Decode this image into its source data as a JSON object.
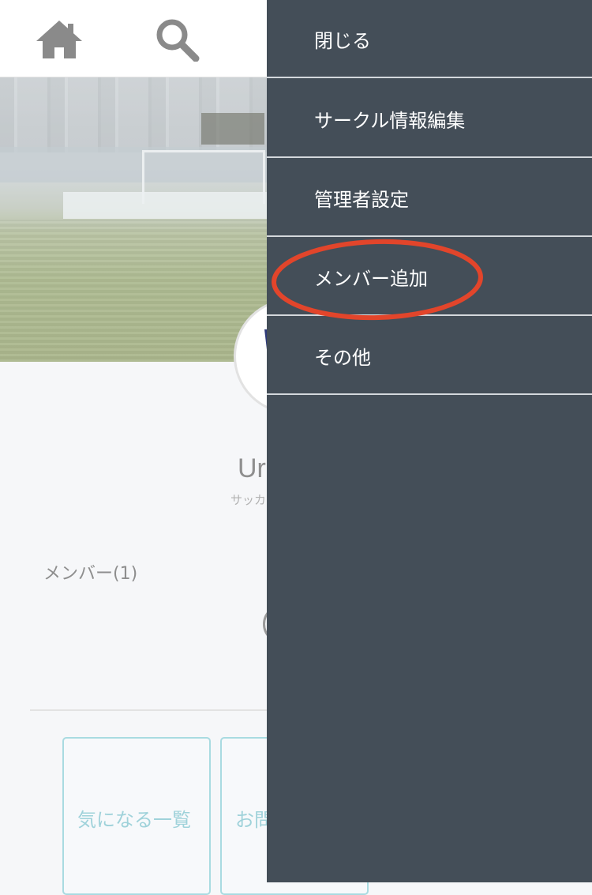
{
  "header": {
    "home_icon": "home-icon",
    "search_icon": "search-icon"
  },
  "circle": {
    "name_partial": "Ur",
    "category_partial": "サッカ"
  },
  "members": {
    "label": "メンバー(1)"
  },
  "actions": [
    {
      "label": "気になる一覧"
    },
    {
      "label": "お問"
    }
  ],
  "menu": {
    "items": [
      {
        "label": "閉じる"
      },
      {
        "label": "サークル情報編集"
      },
      {
        "label": "管理者設定"
      },
      {
        "label": "メンバー追加"
      },
      {
        "label": "その他"
      }
    ]
  },
  "colors": {
    "menu_background": "#444e58",
    "highlight_ring": "#e2452b",
    "button_accent": "#a9dbe1"
  }
}
